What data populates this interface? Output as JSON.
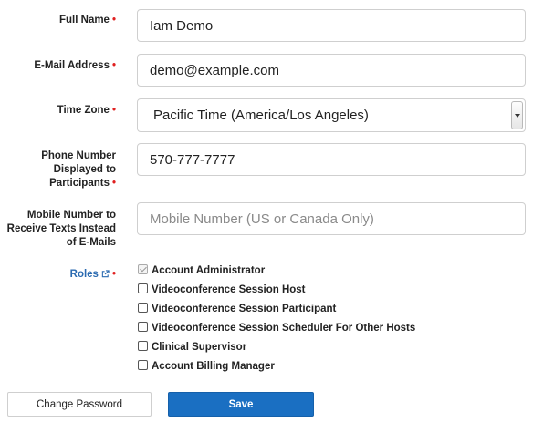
{
  "form": {
    "full_name": {
      "label": "Full Name",
      "value": "Iam Demo"
    },
    "email": {
      "label": "E-Mail Address",
      "value": "demo@example.com"
    },
    "time_zone": {
      "label": "Time Zone",
      "value": "Pacific Time (America/Los Angeles)"
    },
    "phone": {
      "label_lines": [
        "Phone Number",
        "Displayed to",
        "Participants"
      ],
      "value": "570-777-7777"
    },
    "mobile": {
      "label_lines": [
        "Mobile Number to",
        "Receive Texts Instead",
        "of E-Mails"
      ],
      "placeholder": "Mobile Number (US or Canada Only)",
      "value": ""
    },
    "required_marker": "•"
  },
  "roles": {
    "label": "Roles",
    "link_icon": "external-link-icon",
    "items": [
      {
        "label": "Account Administrator",
        "checked": true,
        "disabled": true
      },
      {
        "label": "Videoconference Session Host",
        "checked": false
      },
      {
        "label": "Videoconference Session Participant",
        "checked": false
      },
      {
        "label": "Videoconference Session Scheduler For Other Hosts",
        "checked": false
      },
      {
        "label": "Clinical Supervisor",
        "checked": false
      },
      {
        "label": "Account Billing Manager",
        "checked": false
      }
    ]
  },
  "buttons": {
    "change_password": "Change Password",
    "save": "Save"
  },
  "colors": {
    "primary": "#1a6fc2",
    "required": "#e02020",
    "link": "#2a6ab0"
  }
}
